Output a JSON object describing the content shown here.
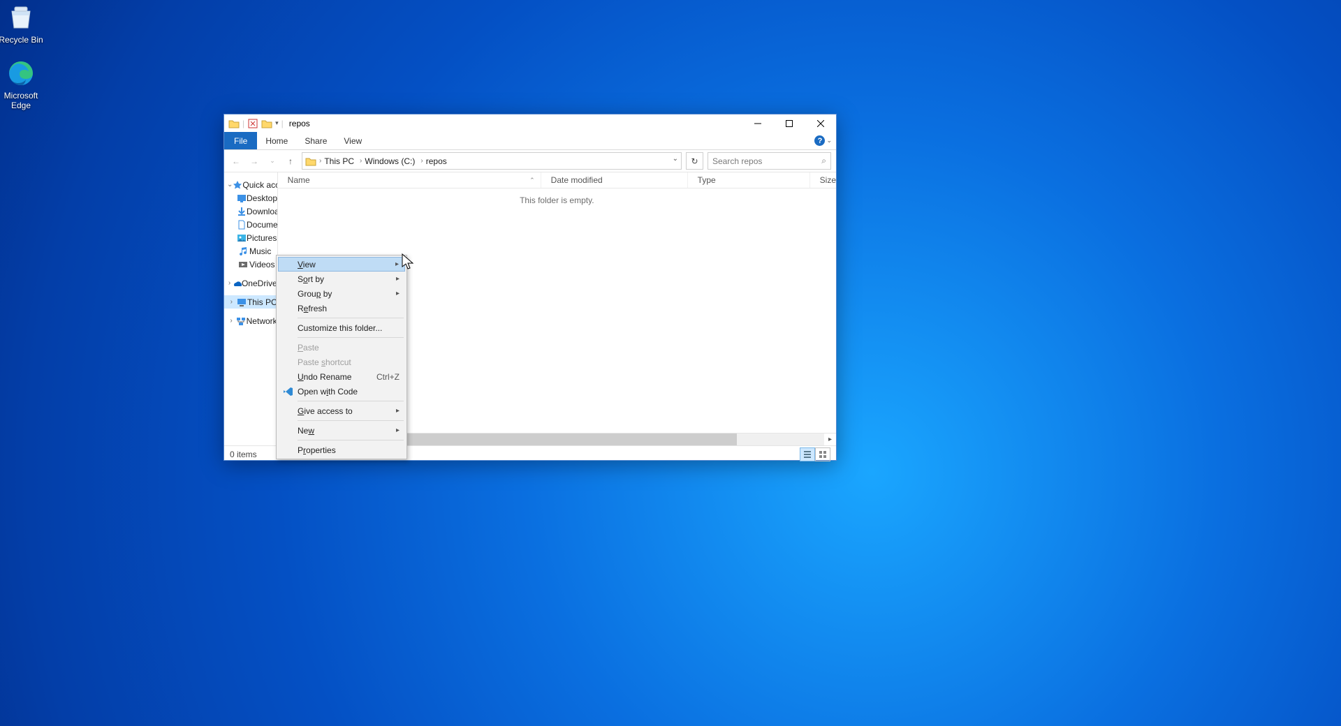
{
  "desktop": {
    "icons": [
      {
        "name": "recycle-bin",
        "label": "Recycle Bin"
      },
      {
        "name": "microsoft-edge",
        "label": "Microsoft Edge"
      }
    ]
  },
  "window": {
    "title": "repos",
    "ribbon": {
      "file": "File",
      "tabs": [
        "Home",
        "Share",
        "View"
      ]
    },
    "address": {
      "crumbs": [
        "This PC",
        "Windows (C:)",
        "repos"
      ]
    },
    "search": {
      "placeholder": "Search repos"
    },
    "columns": [
      "Name",
      "Date modified",
      "Type",
      "Size"
    ],
    "empty_message": "This folder is empty.",
    "status": "0 items"
  },
  "nav": {
    "quick_access": "Quick access",
    "quick_items": [
      {
        "label": "Desktop",
        "icon": "desktop",
        "pinned": true
      },
      {
        "label": "Downloads",
        "icon": "downloads",
        "pinned": true
      },
      {
        "label": "Documents",
        "icon": "documents",
        "pinned": true
      },
      {
        "label": "Pictures",
        "icon": "pictures",
        "pinned": true
      },
      {
        "label": "Music",
        "icon": "music",
        "pinned": false
      },
      {
        "label": "Videos",
        "icon": "videos",
        "pinned": false
      }
    ],
    "onedrive": "OneDrive",
    "this_pc": "This PC",
    "network": "Network"
  },
  "context_menu": {
    "view": "View",
    "sort_by": "Sort by",
    "group_by": "Group by",
    "refresh": "Refresh",
    "customize": "Customize this folder...",
    "paste": "Paste",
    "paste_shortcut": "Paste shortcut",
    "undo_rename": "Undo Rename",
    "undo_shortcut": "Ctrl+Z",
    "open_with_code": "Open with Code",
    "give_access": "Give access to",
    "new": "New",
    "properties": "Properties"
  }
}
